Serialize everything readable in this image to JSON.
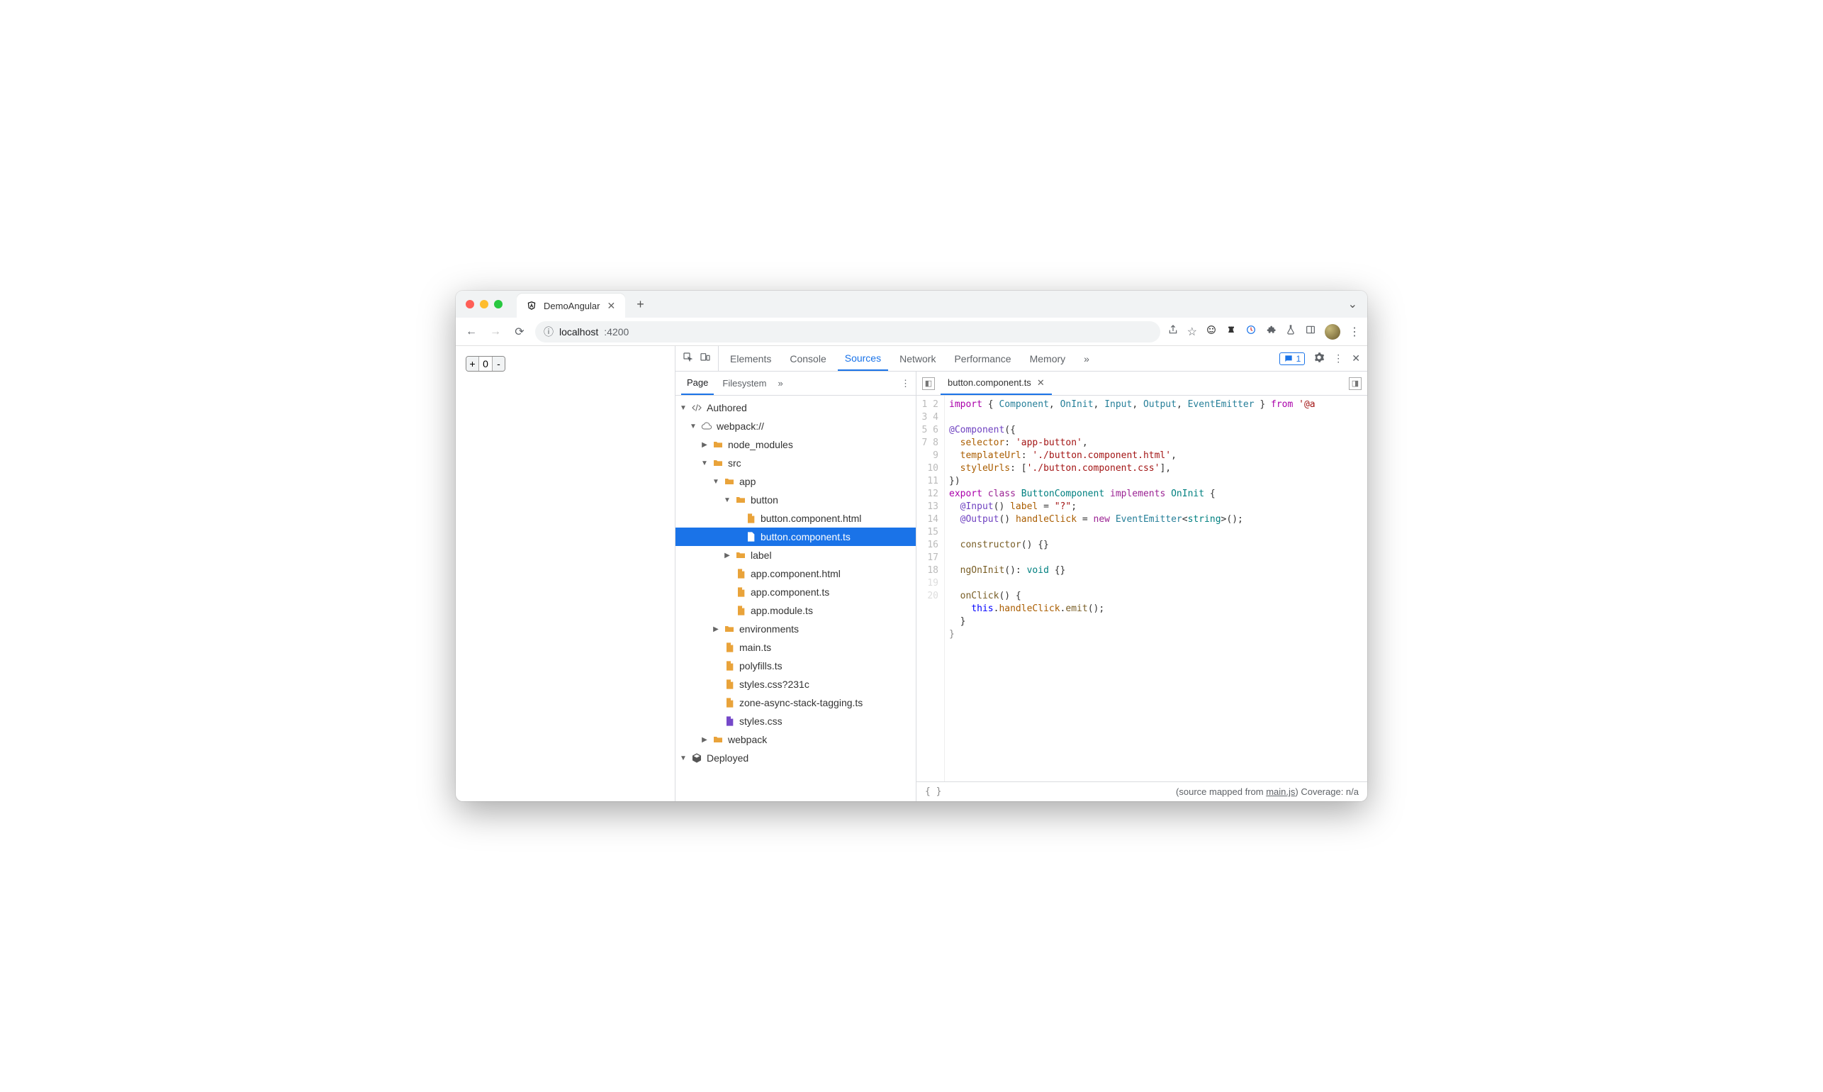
{
  "browser": {
    "tab_title": "DemoAngular",
    "url_host": "localhost",
    "url_port": ":4200"
  },
  "page": {
    "counter_value": "0",
    "plus": "+",
    "minus": "-"
  },
  "devtools": {
    "tabs": [
      "Elements",
      "Console",
      "Sources",
      "Network",
      "Performance",
      "Memory"
    ],
    "active_tab": "Sources",
    "issues_count": "1"
  },
  "sources": {
    "subtabs": [
      "Page",
      "Filesystem"
    ],
    "active_subtab": "Page",
    "tree": {
      "authored": "Authored",
      "webpack": "webpack://",
      "node_modules": "node_modules",
      "src": "src",
      "app": "app",
      "button": "button",
      "button_html": "button.component.html",
      "button_ts": "button.component.ts",
      "label": "label",
      "app_html": "app.component.html",
      "app_ts": "app.component.ts",
      "app_module": "app.module.ts",
      "environments": "environments",
      "main_ts": "main.ts",
      "polyfills": "polyfills.ts",
      "styles_q": "styles.css?231c",
      "zone": "zone-async-stack-tagging.ts",
      "styles": "styles.css",
      "webpack_dir": "webpack",
      "deployed": "Deployed"
    }
  },
  "editor": {
    "open_file": "button.component.ts",
    "lines": 20
  },
  "status": {
    "source_mapped": "(source mapped from ",
    "mainjs": "main.js",
    "coverage": ")  Coverage: n/a"
  }
}
